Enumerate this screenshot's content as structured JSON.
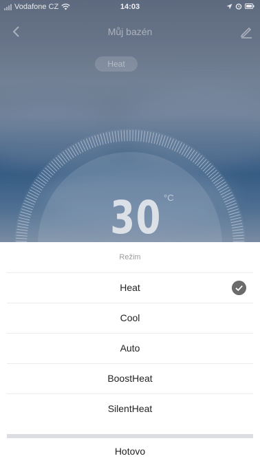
{
  "status_bar": {
    "carrier": "Vodafone CZ",
    "time": "14:03",
    "icons": [
      "signal-icon",
      "wifi-icon",
      "location-icon",
      "alarm-icon",
      "battery-icon"
    ]
  },
  "nav": {
    "title": "Můj bazén",
    "back_icon": "chevron-left-icon",
    "edit_icon": "edit-icon"
  },
  "device": {
    "current_mode": "Heat",
    "temperature": "30",
    "unit": "°C"
  },
  "sheet": {
    "title": "Režim",
    "options": [
      {
        "label": "Heat",
        "selected": true
      },
      {
        "label": "Cool",
        "selected": false
      },
      {
        "label": "Auto",
        "selected": false
      },
      {
        "label": "BoostHeat",
        "selected": false
      },
      {
        "label": "SilentHeat",
        "selected": false
      }
    ],
    "done_label": "Hotovo"
  },
  "colors": {
    "sheet_background": "#ffffff",
    "check_badge": "#6b6b6b",
    "separator": "#dcdde3"
  }
}
